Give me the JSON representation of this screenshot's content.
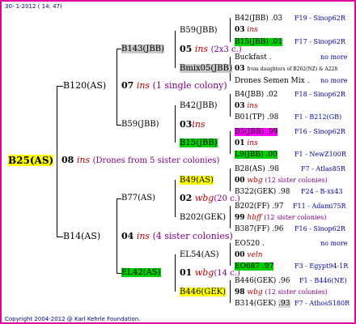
{
  "header": "30-  1-2012 ( 14: 47)",
  "footer": "Copyright 2004-2012 @ Karl Kehrle Foundation.",
  "colors": {
    "border": "#e000a0",
    "ins": "#c00000",
    "note": "#800080",
    "code": "#0000a0",
    "yellow": "#ffff00",
    "green": "#00d000",
    "gray": "#c8c8c8",
    "magenta": "#ff00ff"
  },
  "root": {
    "name": "B25(AS)",
    "year": "08",
    "mark": "ins",
    "note": "(Drones from 5 sister colonies)"
  },
  "gen1": [
    {
      "name": "B120(AS)",
      "year": "07",
      "mark": "ins",
      "note": "(1 single colony)"
    },
    {
      "name": "B14(AS)",
      "year": "04",
      "mark": "ins",
      "note": "(4 sister colonies)"
    }
  ],
  "gen2": [
    {
      "name": "B143(JBB)",
      "year": "05",
      "mark": "ins",
      "note": "(2x3 c.)"
    },
    {
      "name": "B59(JBB)",
      "year": "03",
      "mark": "ins",
      "note": ""
    },
    {
      "name": "B77(AS)",
      "year": "02",
      "mark": "wbg",
      "note": "(20 c.)"
    },
    {
      "name": "EL42(AS)",
      "year": "01",
      "mark": "wbg",
      "note": "(14 c.)"
    }
  ],
  "gen3": [
    "B59(JBB)",
    "Bmix05(JBB)",
    "B42(JBB)",
    "B15(JBB)",
    "B49(AS)",
    "B202(GEK)",
    "EL54(AS)",
    "B446(GEK)"
  ],
  "gen4": [
    {
      "name": "B42(JBB)",
      "val": ".03",
      "code": "F19 - Sinop62R"
    },
    {
      "name": "03",
      "val": "ins",
      "code": ""
    },
    {
      "name": "B15(JBB)",
      "val": ".01",
      "code": "F17 - Sinop62R"
    },
    {
      "name": "Buckfast",
      "val": ".",
      "code": "no more"
    },
    {
      "name": "03",
      "val": "from daughters of B262(NZ) & A228",
      "code": ""
    },
    {
      "name": "Drones Semen Mix",
      "val": ".",
      "code": "no more"
    },
    {
      "name": "B4(JBB)",
      "val": ".02",
      "code": "F18 - Sinop62R"
    },
    {
      "name": "03",
      "val": "ins",
      "code": ""
    },
    {
      "name": "B01(TP)",
      "val": ".98",
      "code": "F1 - B212(GB)"
    },
    {
      "name": "B5(JBB)",
      "val": ".99",
      "code": "F16 - Sinop62R"
    },
    {
      "name": "01",
      "val": "ins",
      "code": ""
    },
    {
      "name": "L9(JBB)",
      "val": ".00",
      "code": "F1 - NewZ100R"
    },
    {
      "name": "B28(AS)",
      "val": ".98",
      "code": "F7 - Atlas85R"
    },
    {
      "name": "00",
      "val": "wbg",
      "code": "(12 sister colonies)"
    },
    {
      "name": "B322(GEK)",
      "val": ".98",
      "code": "F24 - B-xx43"
    },
    {
      "name": "B202(FF)",
      "val": ".97",
      "code": "F11 - Adami75R"
    },
    {
      "name": "99",
      "val": "hbff",
      "code": "(12 sister colonies)"
    },
    {
      "name": "B387(FF)",
      "val": ".96",
      "code": "F16 - Sinop62R"
    },
    {
      "name": "EO520",
      "val": ".",
      "code": "no more"
    },
    {
      "name": "00",
      "val": "vеln",
      "code": ""
    },
    {
      "name": "EO687",
      "val": ".97",
      "code": "F3 - Egypt94-1R"
    },
    {
      "name": "B446(GEK)",
      "val": ".96",
      "code": "F1 - B446(NE)"
    },
    {
      "name": "98",
      "val": "wbg",
      "code": "(12 sister colonies)"
    },
    {
      "name": "B314(GEK)",
      "val": ".93",
      "code": "F7 - AthosS180R"
    }
  ]
}
